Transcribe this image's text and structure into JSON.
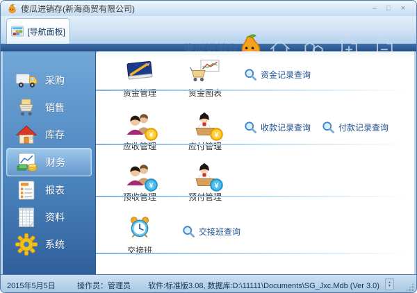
{
  "window": {
    "title": "傻瓜进销存(新海商贸有限公司)",
    "app_icon": "pear-mascot-icon",
    "controls": {
      "minimize": "–",
      "maximize": "□",
      "close": "×"
    }
  },
  "nav_tab": {
    "label": "[导航面板]",
    "icon": "nav-grid-icon"
  },
  "header": {
    "watermark": "傻瓜进销存",
    "mascot_icon": "pear-mascot-icon",
    "ghost_icons": [
      "home-icon",
      "cubes-icon",
      "doc-plus-icon",
      "doc-minus-icon"
    ]
  },
  "sidebar": {
    "items": [
      {
        "label": "采购",
        "icon": "truck-icon",
        "active": false
      },
      {
        "label": "销售",
        "icon": "cart-icon",
        "active": false
      },
      {
        "label": "库存",
        "icon": "house-icon",
        "active": false
      },
      {
        "label": "财务",
        "icon": "finance-chart-icon",
        "active": true
      },
      {
        "label": "报表",
        "icon": "report-icon",
        "active": false
      },
      {
        "label": "资料",
        "icon": "spreadsheet-icon",
        "active": false
      },
      {
        "label": "系统",
        "icon": "gear-icon",
        "active": false
      }
    ]
  },
  "content": {
    "rows": [
      {
        "items": [
          {
            "type": "icon-button",
            "label": "资金管理",
            "icon": "ledger-book-icon"
          },
          {
            "type": "icon-button",
            "label": "资金图表",
            "icon": "cart-chart-icon"
          },
          {
            "type": "query-link",
            "label": "资金记录查询",
            "icon": "search-icon"
          }
        ]
      },
      {
        "items": [
          {
            "type": "icon-button",
            "label": "应收管理",
            "icon": "people-coin-gold-icon"
          },
          {
            "type": "icon-button",
            "label": "应付管理",
            "icon": "person-coin-gold-icon"
          },
          {
            "type": "query-link",
            "label": "收款记录查询",
            "icon": "search-icon"
          },
          {
            "type": "query-link",
            "label": "付款记录查询",
            "icon": "search-icon"
          }
        ]
      },
      {
        "items": [
          {
            "type": "icon-button",
            "label": "预收管理",
            "icon": "people-coin-blue-icon"
          },
          {
            "type": "icon-button",
            "label": "预付管理",
            "icon": "person-coin-blue-icon"
          }
        ]
      },
      {
        "items": [
          {
            "type": "icon-button",
            "label": "交接班",
            "icon": "alarm-clock-icon"
          },
          {
            "type": "query-link",
            "label": "交接班查询",
            "icon": "search-icon"
          }
        ]
      }
    ]
  },
  "statusbar": {
    "date": "2015年5月5日",
    "operator": "操作员：管理员",
    "software": "软件:标准版3.08,  数据库:D:\\11111\\Documents\\SG_Jxc.Mdb (Ver 3.0)"
  },
  "palette": {
    "frame_blue": "#4f7cab",
    "sidebar_blue": "#4a82bc",
    "dark_bar": "#2d5e9a",
    "link_blue": "#1c4e8f",
    "coin_gold": "#f7b500",
    "coin_blue": "#29a8e0"
  }
}
